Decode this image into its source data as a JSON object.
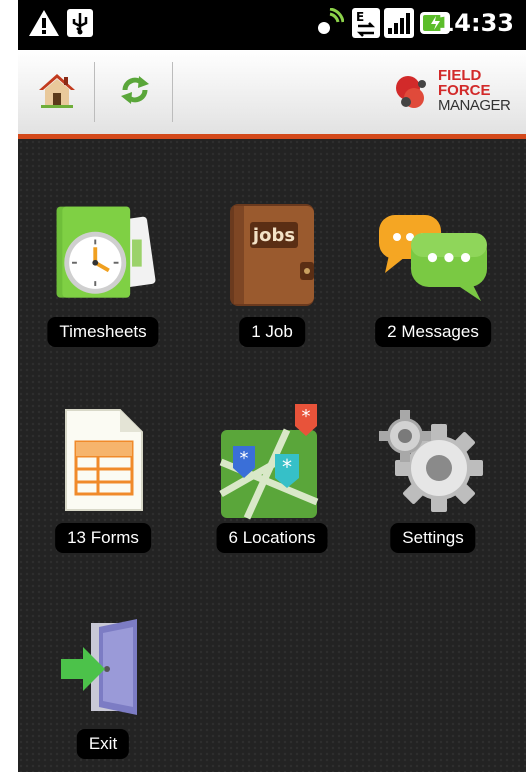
{
  "status_bar": {
    "time": "14:33",
    "icons": [
      "warning-icon",
      "usb-icon",
      "gps-icon",
      "data-transfer-icon",
      "signal-icon",
      "battery-icon"
    ],
    "data_badge": "E"
  },
  "toolbar": {
    "home_icon": "home-icon",
    "sync_icon": "sync-icon",
    "logo": {
      "line1": "FIELD",
      "line2": "FORCE",
      "line3": "MANAGER",
      "accent": "#d22a2a"
    },
    "accent_rule_color": "#d4491b"
  },
  "menu": {
    "timesheets": "Timesheets",
    "jobs": "1 Job",
    "jobs_cover": "jobs",
    "messages": "2 Messages",
    "messages_dots": "•••",
    "forms": "13 Forms",
    "locations": "6 Locations",
    "settings": "Settings",
    "exit": "Exit"
  }
}
